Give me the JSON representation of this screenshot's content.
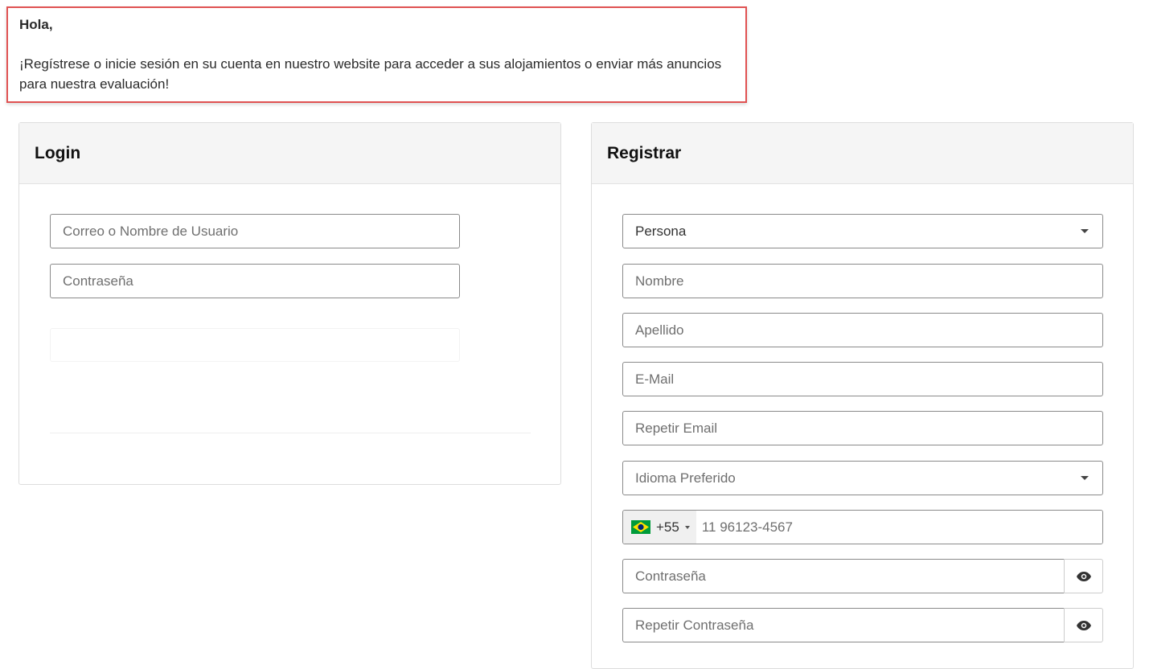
{
  "notice": {
    "greeting": "Hola,",
    "message": "¡Regístrese o inicie sesión en su cuenta en nuestro website para acceder a sus alojamientos o enviar más anuncios para nuestra evaluación!"
  },
  "login": {
    "title": "Login",
    "user_placeholder": "Correo o Nombre de Usuario",
    "password_placeholder": "Contraseña"
  },
  "register": {
    "title": "Registrar",
    "type_value": "Persona",
    "name_placeholder": "Nombre",
    "lastname_placeholder": "Apellido",
    "email_placeholder": "E-Mail",
    "repeat_email_placeholder": "Repetir Email",
    "language_placeholder": "Idioma Preferido",
    "phone_code": "+55",
    "phone_placeholder": "11 96123-4567",
    "password_placeholder": "Contraseña",
    "repeat_password_placeholder": "Repetir Contraseña"
  },
  "icons": {
    "flag": "brazil-flag-icon",
    "eye": "eye-icon",
    "caret": "caret-down-icon"
  },
  "colors": {
    "notice_border": "#e05252",
    "panel_header_bg": "#f5f5f5",
    "input_border": "#8a8a8a"
  }
}
